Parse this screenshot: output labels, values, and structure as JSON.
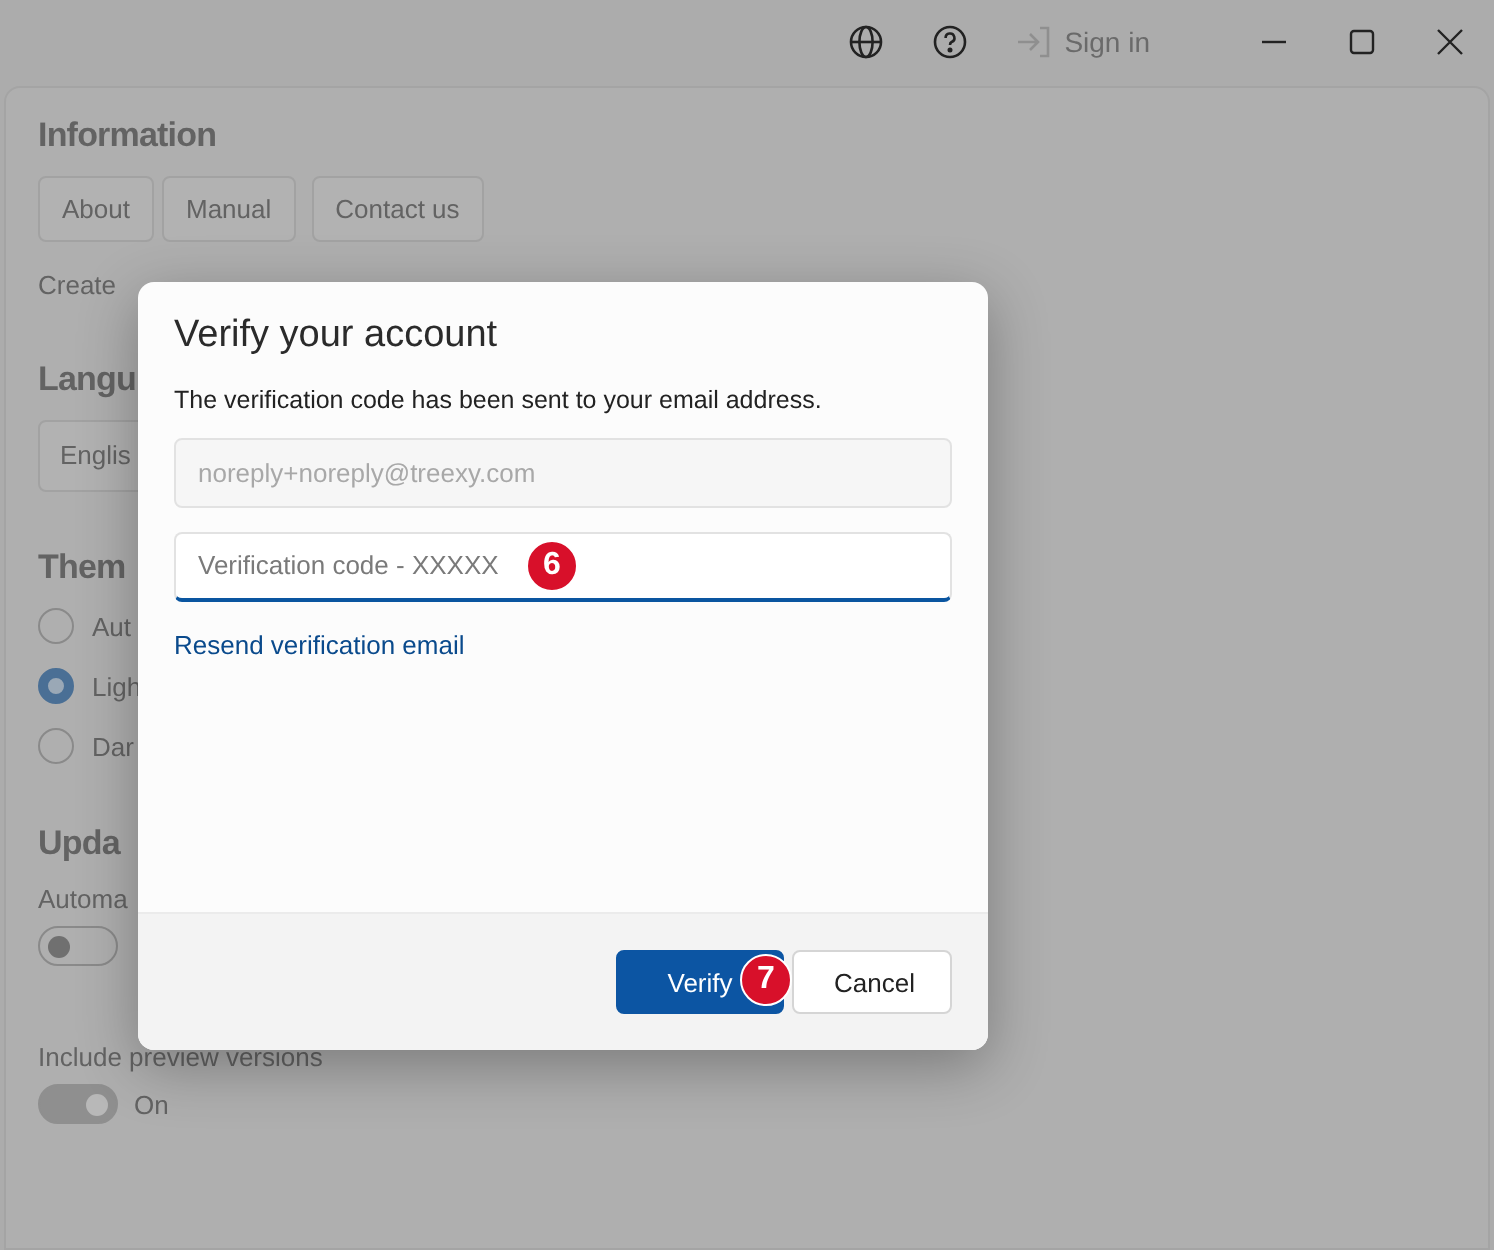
{
  "title_bar": {
    "sign_in": "Sign in"
  },
  "settings": {
    "information": {
      "heading": "Information",
      "buttons": [
        "About",
        "Manual",
        "Contact us"
      ],
      "text": "Create"
    },
    "language": {
      "heading": "Langu",
      "value": "Englis"
    },
    "theme": {
      "heading": "Them",
      "options": [
        {
          "label": "Aut",
          "selected": false
        },
        {
          "label": "Ligh",
          "selected": true
        },
        {
          "label": "Dar",
          "selected": false
        }
      ]
    },
    "updates": {
      "heading": "Upda",
      "toggles": [
        {
          "label": "Automa",
          "on": false
        },
        {
          "label": "Include preview versions",
          "on": true,
          "state": "On"
        }
      ]
    }
  },
  "dialog": {
    "title": "Verify your account",
    "message": "The verification code has been sent to your email address.",
    "email_field": {
      "value": "noreply+noreply@treexy.com",
      "disabled": true
    },
    "code_field": {
      "placeholder": "Verification code - XXXXX",
      "marker": "6"
    },
    "link": "Resend verification email",
    "buttons": [
      {
        "label": "Verify",
        "kind": "primary",
        "marker": "7"
      },
      {
        "label": "Cancel",
        "kind": "secondary"
      }
    ]
  }
}
